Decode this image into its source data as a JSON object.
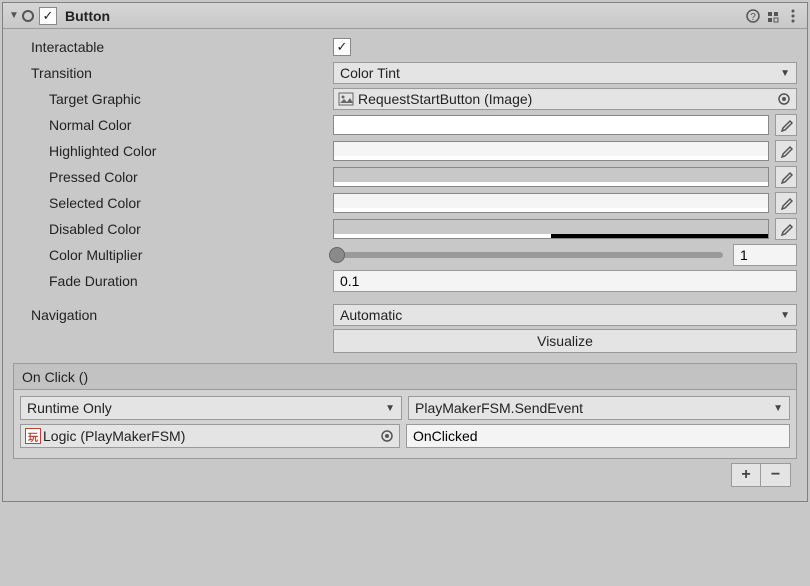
{
  "header": {
    "title": "Button",
    "enabled": true
  },
  "props": {
    "interactable_label": "Interactable",
    "interactable": true,
    "transition_label": "Transition",
    "transition_value": "Color Tint",
    "target_graphic_label": "Target Graphic",
    "target_graphic_value": "RequestStartButton (Image)",
    "normal_color_label": "Normal Color",
    "normal_color": "#ffffff",
    "normal_alpha": 100,
    "highlighted_color_label": "Highlighted Color",
    "highlighted_color": "#f5f5f5",
    "highlighted_alpha": 100,
    "pressed_color_label": "Pressed Color",
    "pressed_color": "#c8c8c8",
    "pressed_alpha": 100,
    "selected_color_label": "Selected Color",
    "selected_color": "#f5f5f5",
    "selected_alpha": 100,
    "disabled_color_label": "Disabled Color",
    "disabled_color": "#c8c8c8",
    "disabled_alpha": 50,
    "color_multiplier_label": "Color Multiplier",
    "color_multiplier": "1",
    "fade_duration_label": "Fade Duration",
    "fade_duration": "0.1",
    "navigation_label": "Navigation",
    "navigation_value": "Automatic",
    "visualize_label": "Visualize"
  },
  "event": {
    "header": "On Click ()",
    "call_state": "Runtime Only",
    "method": "PlayMakerFSM.SendEvent",
    "target": "Logic (PlayMakerFSM)",
    "argument": "OnClicked"
  }
}
